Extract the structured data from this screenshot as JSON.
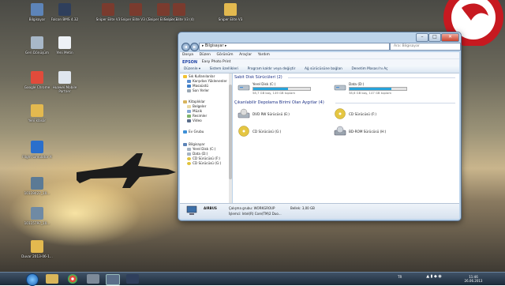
{
  "desktop": {
    "icons": [
      {
        "name": "computer",
        "label": "Bilgisayar",
        "color": "#5d84b8"
      },
      {
        "name": "sim",
        "label": "Falcon BMS 4.32",
        "color": "#2f3f5c"
      },
      {
        "name": "sniper1",
        "label": "Sniper Elite V3",
        "color": "#7a3b2e"
      },
      {
        "name": "sniper2",
        "label": "Sniper Elite V3 (2)",
        "color": "#7a3b2e"
      },
      {
        "name": "sniper3",
        "label": "Sniper Elite V3 (3)",
        "color": "#7a3b2e"
      },
      {
        "name": "sniper4",
        "label": "Sniper Elite V3 (4)",
        "color": "#7a3b2e"
      },
      {
        "name": "folder1",
        "label": "Sniper Elite V3",
        "color": "#e3b94f"
      },
      {
        "name": "recycle",
        "label": "Geri Dönüşüm",
        "color": "#a8b8c8"
      },
      {
        "name": "file1",
        "label": "Yeni Metin",
        "color": "#eef2f6"
      },
      {
        "name": "chrome",
        "label": "Google Chrome",
        "color": "#e14b3b"
      },
      {
        "name": "device",
        "label": "Huawei Mobile Partner",
        "color": "#dfe6ee"
      },
      {
        "name": "folder2",
        "label": "Yeni klasör",
        "color": "#e3b94f"
      },
      {
        "name": "flightsim",
        "label": "Flight Simulator X",
        "color": "#2a6fcc"
      },
      {
        "name": "photo1",
        "label": "10119427_10...",
        "color": "#5b7a95"
      },
      {
        "name": "photo2",
        "label": "10115797_10...",
        "color": "#6f8aa4"
      },
      {
        "name": "folder3",
        "label": "Duvar 2013-06-1...",
        "color": "#e3b94f"
      }
    ]
  },
  "window": {
    "address": "▸ Bilgisayar ▸",
    "search_placeholder": "Ara: Bilgisayar",
    "menu": [
      "Dosya",
      "Düzen",
      "Görünüm",
      "Araçlar",
      "Yardım"
    ],
    "epson": {
      "brand": "EPSON",
      "product": "Easy Photo Print"
    },
    "commands": [
      "Düzenle ▾",
      "Sistem özellikleri",
      "Program kaldır veya değiştir",
      "Ağ sürücüsüne bağlan",
      "Denetim Masası'nı Aç"
    ],
    "nav": {
      "favorites_title": "Sık Kullanılanlar",
      "favorites": [
        "Karşıdan Yüklenenler",
        "Masaüstü",
        "Son Yerler"
      ],
      "libraries_title": "Kitaplıklar",
      "libraries": [
        "Belgeler",
        "Müzik",
        "Resimler",
        "Video"
      ],
      "homegroup": "Ev Grubu",
      "computer_title": "Bilgisayar",
      "drives": [
        "Yerel Disk (C:)",
        "Data (D:)",
        "CD Sürücüsü (F:)",
        "CD Sürücüsü (G:)"
      ]
    },
    "hdd_group": "Sabit Disk Sürücüleri (2)",
    "hdd": [
      {
        "label": "Yerel Disk (C:)",
        "free": "58,7 GB boş, 149 GB toplam",
        "used_fraction": 0.61
      },
      {
        "label": "Data (D:)",
        "free": "38,6 GB boş, 147 GB toplam",
        "used_fraction": 0.74
      }
    ],
    "removable_group": "Çıkarılabilir Depolama Birimi Olan Aygıtlar (4)",
    "removable": [
      {
        "label": "DVD RW Sürücüsü (E:)",
        "kind": "dvd"
      },
      {
        "label": "CD Sürücüsü (F:)",
        "kind": "cd"
      },
      {
        "label": "CD Sürücüsü (G:)",
        "kind": "cd"
      },
      {
        "label": "BD-ROM Sürücüsü (H:)",
        "kind": "bd"
      }
    ],
    "details": {
      "computer_name": "AIRBUS",
      "workgroup": "Çalışma grubu: WORKGROUP",
      "memory": "Bellek: 3,00 GB",
      "processor": "İşlemci: Intel(R) Core(TM)2 Duo..."
    }
  },
  "taskbar": {
    "lang": "TR",
    "time": "11:46",
    "date": "26.06.2013"
  }
}
